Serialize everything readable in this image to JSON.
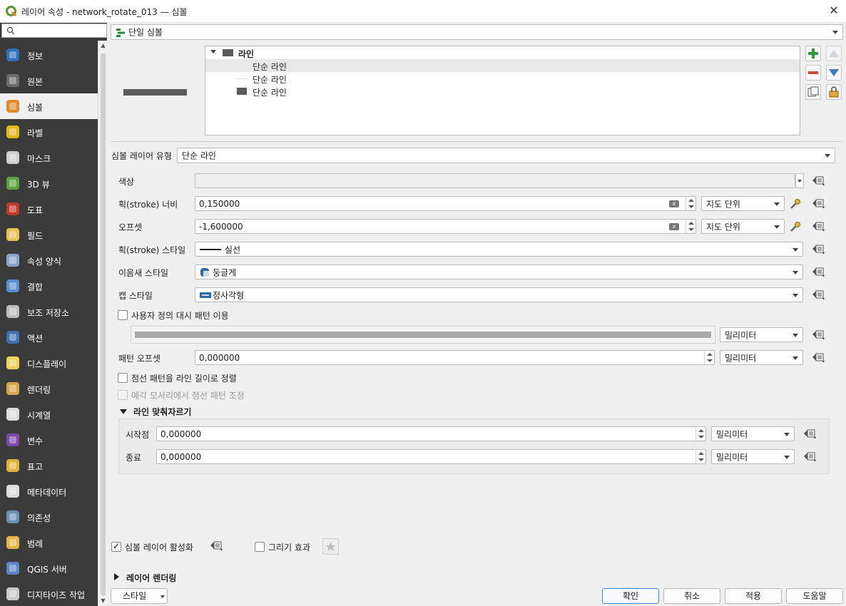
{
  "window": {
    "title": "레이어 속성 - network_rotate_013 — 심볼",
    "close_label": "✕"
  },
  "search": {
    "placeholder": ""
  },
  "sidebar": {
    "items": [
      {
        "label": "정보",
        "icon": "info-icon"
      },
      {
        "label": "원본",
        "icon": "source-icon"
      },
      {
        "label": "심볼",
        "icon": "symbology-icon",
        "selected": true
      },
      {
        "label": "라벨",
        "icon": "labels-icon"
      },
      {
        "label": "마스크",
        "icon": "mask-icon"
      },
      {
        "label": "3D 뷰",
        "icon": "3d-view-icon"
      },
      {
        "label": "도표",
        "icon": "diagram-icon"
      },
      {
        "label": "필드",
        "icon": "fields-icon"
      },
      {
        "label": "속성 양식",
        "icon": "attributes-form-icon"
      },
      {
        "label": "결합",
        "icon": "joins-icon"
      },
      {
        "label": "보조 저장소",
        "icon": "auxiliary-storage-icon"
      },
      {
        "label": "액션",
        "icon": "actions-icon"
      },
      {
        "label": "디스플레이",
        "icon": "display-icon"
      },
      {
        "label": "렌더링",
        "icon": "rendering-icon"
      },
      {
        "label": "시계열",
        "icon": "temporal-icon"
      },
      {
        "label": "변수",
        "icon": "variables-icon"
      },
      {
        "label": "표고",
        "icon": "elevation-icon"
      },
      {
        "label": "메타데이터",
        "icon": "metadata-icon"
      },
      {
        "label": "의존성",
        "icon": "dependencies-icon"
      },
      {
        "label": "범례",
        "icon": "legend-icon"
      },
      {
        "label": "QGIS 서버",
        "icon": "qgis-server-icon"
      },
      {
        "label": "디지타이즈 작업",
        "icon": "digitizing-icon"
      }
    ]
  },
  "renderer": {
    "type_label": "단일 심볼"
  },
  "symbol_tree": {
    "root_label": "라인",
    "layers": [
      "단순 라인",
      "단순 라인",
      "단순 라인"
    ]
  },
  "symbol_layer": {
    "type_label": "심볼 레이어 유형",
    "type_value": "단순 라인",
    "color_label": "색상",
    "stroke_width_label": "획(stroke) 너비",
    "stroke_width_value": "0,150000",
    "stroke_width_unit": "지도 단위",
    "offset_label": "오프셋",
    "offset_value": "-1,600000",
    "offset_unit": "지도 단위",
    "stroke_style_label": "획(stroke) 스타일",
    "stroke_style_value": "실선",
    "join_style_label": "이음새 스타일",
    "join_style_value": "둥글게",
    "cap_style_label": "캡 스타일",
    "cap_style_value": "정사각형",
    "custom_dash_label": "사용자 정의 대시 패턴 이용",
    "custom_dash_checked": false,
    "dash_unit": "밀리미터",
    "pattern_offset_label": "패턴 오프셋",
    "pattern_offset_value": "0,000000",
    "pattern_offset_unit": "밀리미터",
    "align_dash_label": "점선 패턴을 라인 길이로 정렬",
    "align_dash_checked": false,
    "tweak_dash_label": "예각 모서리에서 점선 패턴 조정",
    "tweak_dash_checked": false,
    "trim_section_label": "라인 맞춰자르기",
    "trim_start_label": "시작점",
    "trim_start_value": "0,000000",
    "trim_start_unit": "밀리미터",
    "trim_end_label": "종료",
    "trim_end_value": "0,000000",
    "trim_end_unit": "밀리미터"
  },
  "bottom": {
    "enable_layer_label": "심볼 레이어 활성화",
    "enable_layer_checked": true,
    "draw_effects_label": "그리기 효과",
    "draw_effects_checked": false,
    "layer_rendering_label": "레이어 렌더링",
    "style_button": "스타일",
    "ok_button": "확인",
    "cancel_button": "취소",
    "apply_button": "적용",
    "help_button": "도움말"
  },
  "colors": {
    "sidebar_bg": "#3b3b3b",
    "preview_line": "#5b5b5b",
    "accent_border": "#4a7fcf"
  }
}
